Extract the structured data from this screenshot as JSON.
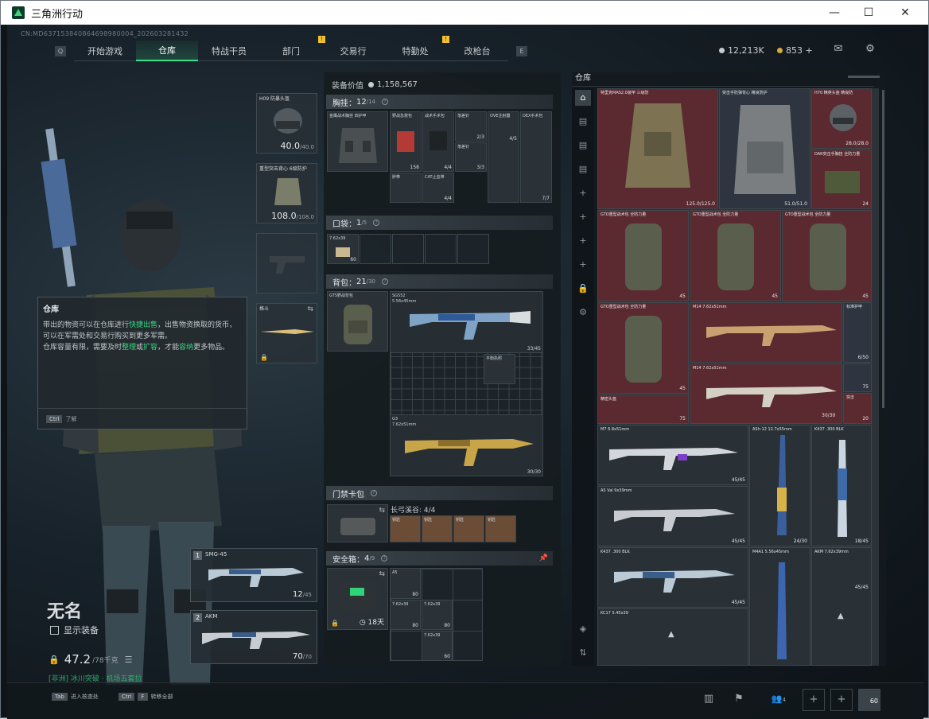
{
  "window": {
    "title": "三角洲行动",
    "min": "—",
    "max": "☐",
    "close": "✕"
  },
  "uid": "CN:MD637153840864698980004_202603281432",
  "nav": {
    "key_left": "Q",
    "key_right": "E",
    "tabs": [
      {
        "label": "开始游戏",
        "active": false,
        "alert": ""
      },
      {
        "label": "仓库",
        "active": true,
        "alert": ""
      },
      {
        "label": "特战干员",
        "active": false,
        "alert": ""
      },
      {
        "label": "部门",
        "active": false,
        "alert": "!"
      },
      {
        "label": "交易行",
        "active": false,
        "alert": ""
      },
      {
        "label": "特勤处",
        "active": false,
        "alert": "!"
      },
      {
        "label": "改枪台",
        "active": false,
        "alert": ""
      }
    ]
  },
  "currency": {
    "silver": "12,213K",
    "gold": "853 +"
  },
  "icons": {
    "mail": "mail-icon",
    "settings": "gear-icon"
  },
  "colors": {
    "accent": "#35e08a",
    "alert": "#f0c030",
    "stash_red": "#5b2a30"
  },
  "tooltip": {
    "title": "仓库",
    "line1a": "带出的物资可以在仓库进行",
    "line1b": "快捷出售",
    "line1c": "，出售物资换取的货币，可以在军需处和交易行购买到更多军需。",
    "line2a": "仓库容量有限，需要及时",
    "line2b": "整理",
    "line2c": "或",
    "line2d": "扩容",
    "line2e": "，才能",
    "line2f": "容纳",
    "line2g": "更多物品。",
    "foot_key": "Ctrl",
    "foot_text": "了解"
  },
  "gear": {
    "helmet_label": "H09 防暴头盔",
    "helmet_val": "40.0",
    "helmet_max": "/40.0",
    "armor_label": "重型突击背心 6级防护",
    "armor_val": "108.0",
    "armor_max": "/108.0",
    "melee_label": "格斗"
  },
  "player": {
    "name": "无名",
    "show_equip": "显示装备",
    "weight": "47.2",
    "weight_max": "/78千克",
    "status": "[非洲] 冰川突破 · 机场五套拉"
  },
  "weapons": [
    {
      "num": "1",
      "name": "SMG-45",
      "ammo": "12",
      "ammo_max": "/45"
    },
    {
      "num": "2",
      "name": "AKM",
      "ammo": "70",
      "ammo_max": "/70"
    }
  ],
  "equip": {
    "value_label": "装备价值",
    "value": "1,158,567",
    "rig_label": "胸挂：",
    "rig_used": "12",
    "rig_max": "/14",
    "rig_item": "金鹰战术胸挂 四护甲",
    "rig_cells": [
      {
        "label": "野战急救包",
        "count": "158"
      },
      {
        "label": "战术手术包",
        "count": "4/4"
      },
      {
        "label": "落差针",
        "count": "2/3"
      },
      {
        "label": "OVE注射器",
        "count": "4/5"
      },
      {
        "label": "DEX手术包",
        "count": "7/7"
      },
      {
        "label": "落差针",
        "count": "3/3"
      },
      {
        "label": "胖带",
        "count": ""
      },
      {
        "label": "CAT止血带",
        "count": "4/4"
      }
    ],
    "pocket_label": "口袋：",
    "pocket_used": "1",
    "pocket_max": "/5",
    "pocket_item": "7.62x39",
    "pocket_item_count": "60",
    "bag_label": "背包：",
    "bag_used": "21",
    "bag_max": "/30",
    "bag_item": "GTS野战背包",
    "bag_guns": [
      {
        "label": "SG552",
        "sub": "5.56x45mm",
        "count": "33/45"
      },
      {
        "label": "G3",
        "sub": "7.62x51mm",
        "count": "30/30"
      }
    ],
    "bag_small": "平衡执照",
    "keycard_label": "门禁卡包",
    "keycard_sub": "长弓溪谷: 4/4",
    "keycards": [
      "钥匙",
      "钥匙",
      "钥匙",
      "钥匙"
    ],
    "safe_label": "安全箱：",
    "safe_used": "4",
    "safe_max": "/9",
    "safe_days": "18天",
    "safe_items": [
      {
        "label": "A5",
        "count": "80"
      },
      {
        "label": "7.62x39",
        "count": "80"
      },
      {
        "label": "7.62x39",
        "count": "80"
      },
      {
        "label": "7.62x39",
        "count": "60"
      }
    ]
  },
  "stash": {
    "title": "仓库",
    "items": [
      {
        "label": "特里克MAS2.0装甲 三级防",
        "val": "125.0/125.0",
        "kind": "red"
      },
      {
        "label": "突击手防弹背心 精良防护",
        "val": "51.0/51.0",
        "kind": "blue"
      },
      {
        "label": "H70 精英头盔 精良防",
        "val": "28.0/28.0",
        "kind": "red"
      },
      {
        "label": "DAR突击手胸挂 全防力量",
        "val": "24",
        "kind": "red"
      },
      {
        "label": "GTO重型战术包 全防力量",
        "val": "45",
        "kind": "red"
      },
      {
        "label": "GTO重型战术包 全防力量",
        "val": "45",
        "kind": "red"
      },
      {
        "label": "GTO重型战术包 全防力量",
        "val": "45",
        "kind": "red"
      },
      {
        "label": "GTO重型战术包 全防力量",
        "val": "45",
        "kind": "red"
      },
      {
        "label": "M14 7.62x51mm",
        "val": "",
        "kind": "red"
      },
      {
        "label": "标准护甲",
        "val": "6/50",
        "kind": "blue"
      },
      {
        "label": "M14 7.62x51mm",
        "val": "",
        "kind": "red"
      },
      {
        "label": "",
        "val": "75",
        "kind": "blue"
      },
      {
        "label": "精密头盔",
        "val": "75",
        "kind": "red"
      },
      {
        "label": "",
        "val": "30/30",
        "kind": "red"
      },
      {
        "label": "突击",
        "val": "20",
        "kind": "red"
      },
      {
        "label": "M7 6.8x51mm",
        "val": "45/45",
        "kind": "dark"
      },
      {
        "label": "ASh-12 12.7x55mm",
        "val": "24/30",
        "kind": "dark"
      },
      {
        "label": "K437 .300 BLK",
        "val": "18/45",
        "kind": "dark"
      },
      {
        "label": "AS Val 9x39mm",
        "val": "45/45",
        "kind": "dark"
      },
      {
        "label": "K437 .300 BLK",
        "val": "45/45",
        "kind": "dark"
      },
      {
        "label": "M4A1 5.56x45mm",
        "val": "",
        "kind": "dark"
      },
      {
        "label": "AKM 7.62x39mm",
        "val": "45/45",
        "kind": "dark"
      },
      {
        "label": "KC17 5.45x39",
        "val": "",
        "kind": "dark"
      }
    ]
  },
  "bottom": {
    "hint1_key": "Tab",
    "hint1": "进入核查处",
    "hint2_key": "Ctrl",
    "hint2_key2": "F",
    "hint2": "转移全部",
    "level": "60",
    "friends": "4"
  }
}
